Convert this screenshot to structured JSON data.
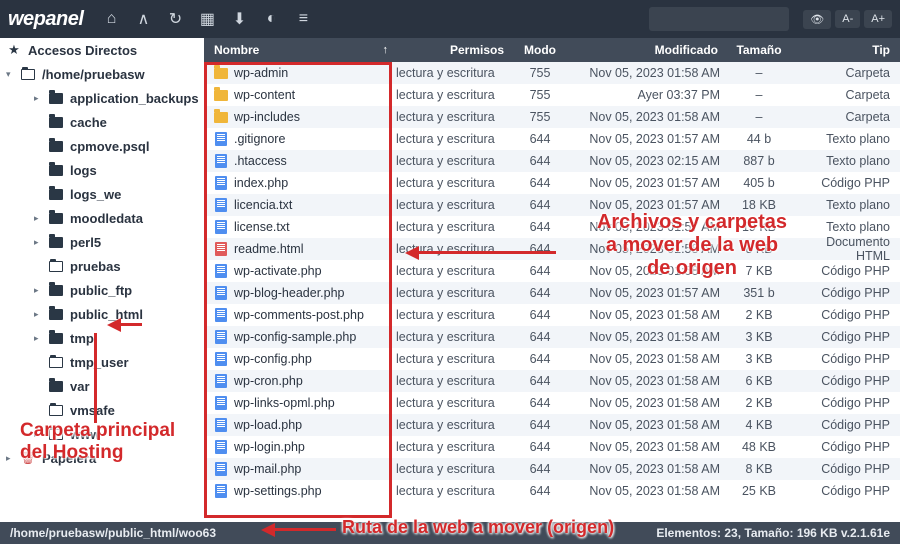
{
  "brand": "wepanel",
  "toolbar": {
    "search_placeholder": "",
    "pills": [
      "A-",
      "A+"
    ]
  },
  "sidebar": {
    "shortcuts_label": "Accesos Directos",
    "root": "/home/pruebasw",
    "items": [
      {
        "label": "application_backups",
        "depth": 2,
        "caret": "▸",
        "open": false
      },
      {
        "label": "cache",
        "depth": 2,
        "caret": "",
        "open": false
      },
      {
        "label": "cpmove.psql",
        "depth": 2,
        "caret": "",
        "open": false
      },
      {
        "label": "logs",
        "depth": 2,
        "caret": "",
        "open": false
      },
      {
        "label": "logs_we",
        "depth": 2,
        "caret": "",
        "open": false
      },
      {
        "label": "moodledata",
        "depth": 2,
        "caret": "▸",
        "open": false
      },
      {
        "label": "perl5",
        "depth": 2,
        "caret": "▸",
        "open": false
      },
      {
        "label": "pruebas",
        "depth": 2,
        "caret": "",
        "open": true
      },
      {
        "label": "public_ftp",
        "depth": 2,
        "caret": "▸",
        "open": false
      },
      {
        "label": "public_html",
        "depth": 2,
        "caret": "▸",
        "open": false,
        "hl": true
      },
      {
        "label": "tmp",
        "depth": 2,
        "caret": "▸",
        "open": false
      },
      {
        "label": "tmp_user",
        "depth": 2,
        "caret": "",
        "open": true
      },
      {
        "label": "var",
        "depth": 2,
        "caret": "",
        "open": false
      },
      {
        "label": "vmsafe",
        "depth": 2,
        "caret": "",
        "open": true
      },
      {
        "label": "www",
        "depth": 2,
        "caret": "▸",
        "open": true
      }
    ],
    "trash_label": "Papelera"
  },
  "columns": {
    "name": "Nombre",
    "perm": "Permisos",
    "mode": "Modo",
    "modified": "Modificado",
    "size": "Tamaño",
    "type": "Tip"
  },
  "files": [
    {
      "name": "wp-admin",
      "icon": "folder",
      "perm": "lectura y escritura",
      "mode": "755",
      "mod": "Nov 05, 2023 01:58 AM",
      "size": "–",
      "type": "Carpeta"
    },
    {
      "name": "wp-content",
      "icon": "folder",
      "perm": "lectura y escritura",
      "mode": "755",
      "mod": "Ayer 03:37 PM",
      "size": "–",
      "type": "Carpeta"
    },
    {
      "name": "wp-includes",
      "icon": "folder",
      "perm": "lectura y escritura",
      "mode": "755",
      "mod": "Nov 05, 2023 01:58 AM",
      "size": "–",
      "type": "Carpeta"
    },
    {
      "name": ".gitignore",
      "icon": "file",
      "perm": "lectura y escritura",
      "mode": "644",
      "mod": "Nov 05, 2023 01:57 AM",
      "size": "44 b",
      "type": "Texto plano"
    },
    {
      "name": ".htaccess",
      "icon": "file",
      "perm": "lectura y escritura",
      "mode": "644",
      "mod": "Nov 05, 2023 02:15 AM",
      "size": "887 b",
      "type": "Texto plano"
    },
    {
      "name": "index.php",
      "icon": "file",
      "perm": "lectura y escritura",
      "mode": "644",
      "mod": "Nov 05, 2023 01:57 AM",
      "size": "405 b",
      "type": "Código PHP"
    },
    {
      "name": "licencia.txt",
      "icon": "file",
      "perm": "lectura y escritura",
      "mode": "644",
      "mod": "Nov 05, 2023 01:57 AM",
      "size": "18 KB",
      "type": "Texto plano"
    },
    {
      "name": "license.txt",
      "icon": "file",
      "perm": "lectura y escritura",
      "mode": "644",
      "mod": "Nov 05, 2023 01:57 AM",
      "size": "19 KB",
      "type": "Texto plano"
    },
    {
      "name": "readme.html",
      "icon": "html",
      "perm": "lectura y escritura",
      "mode": "644",
      "mod": "Nov 05, 2023 01:58 AM",
      "size": "8 KB",
      "type": "Documento HTML"
    },
    {
      "name": "wp-activate.php",
      "icon": "file",
      "perm": "lectura y escritura",
      "mode": "644",
      "mod": "Nov 05, 2023 01:58 AM",
      "size": "7 KB",
      "type": "Código PHP"
    },
    {
      "name": "wp-blog-header.php",
      "icon": "file",
      "perm": "lectura y escritura",
      "mode": "644",
      "mod": "Nov 05, 2023 01:57 AM",
      "size": "351 b",
      "type": "Código PHP"
    },
    {
      "name": "wp-comments-post.php",
      "icon": "file",
      "perm": "lectura y escritura",
      "mode": "644",
      "mod": "Nov 05, 2023 01:58 AM",
      "size": "2 KB",
      "type": "Código PHP"
    },
    {
      "name": "wp-config-sample.php",
      "icon": "file",
      "perm": "lectura y escritura",
      "mode": "644",
      "mod": "Nov 05, 2023 01:58 AM",
      "size": "3 KB",
      "type": "Código PHP"
    },
    {
      "name": "wp-config.php",
      "icon": "file",
      "perm": "lectura y escritura",
      "mode": "644",
      "mod": "Nov 05, 2023 01:58 AM",
      "size": "3 KB",
      "type": "Código PHP"
    },
    {
      "name": "wp-cron.php",
      "icon": "file",
      "perm": "lectura y escritura",
      "mode": "644",
      "mod": "Nov 05, 2023 01:58 AM",
      "size": "6 KB",
      "type": "Código PHP"
    },
    {
      "name": "wp-links-opml.php",
      "icon": "file",
      "perm": "lectura y escritura",
      "mode": "644",
      "mod": "Nov 05, 2023 01:58 AM",
      "size": "2 KB",
      "type": "Código PHP"
    },
    {
      "name": "wp-load.php",
      "icon": "file",
      "perm": "lectura y escritura",
      "mode": "644",
      "mod": "Nov 05, 2023 01:58 AM",
      "size": "4 KB",
      "type": "Código PHP"
    },
    {
      "name": "wp-login.php",
      "icon": "file",
      "perm": "lectura y escritura",
      "mode": "644",
      "mod": "Nov 05, 2023 01:58 AM",
      "size": "48 KB",
      "type": "Código PHP"
    },
    {
      "name": "wp-mail.php",
      "icon": "file",
      "perm": "lectura y escritura",
      "mode": "644",
      "mod": "Nov 05, 2023 01:58 AM",
      "size": "8 KB",
      "type": "Código PHP"
    },
    {
      "name": "wp-settings.php",
      "icon": "file",
      "perm": "lectura y escritura",
      "mode": "644",
      "mod": "Nov 05, 2023 01:58 AM",
      "size": "25 KB",
      "type": "Código PHP"
    }
  ],
  "status": {
    "path": "/home/pruebasw/public_html/woo63",
    "info": "Elementos: 23, Tamaño: 196 KB v.2.1.61e"
  },
  "annotations": {
    "files_box": "Archivos y carpetas a mover de la web de origen",
    "main_folder": "Carpeta principal del Hosting",
    "path_label": "Ruta de la web a mover (origen)"
  }
}
